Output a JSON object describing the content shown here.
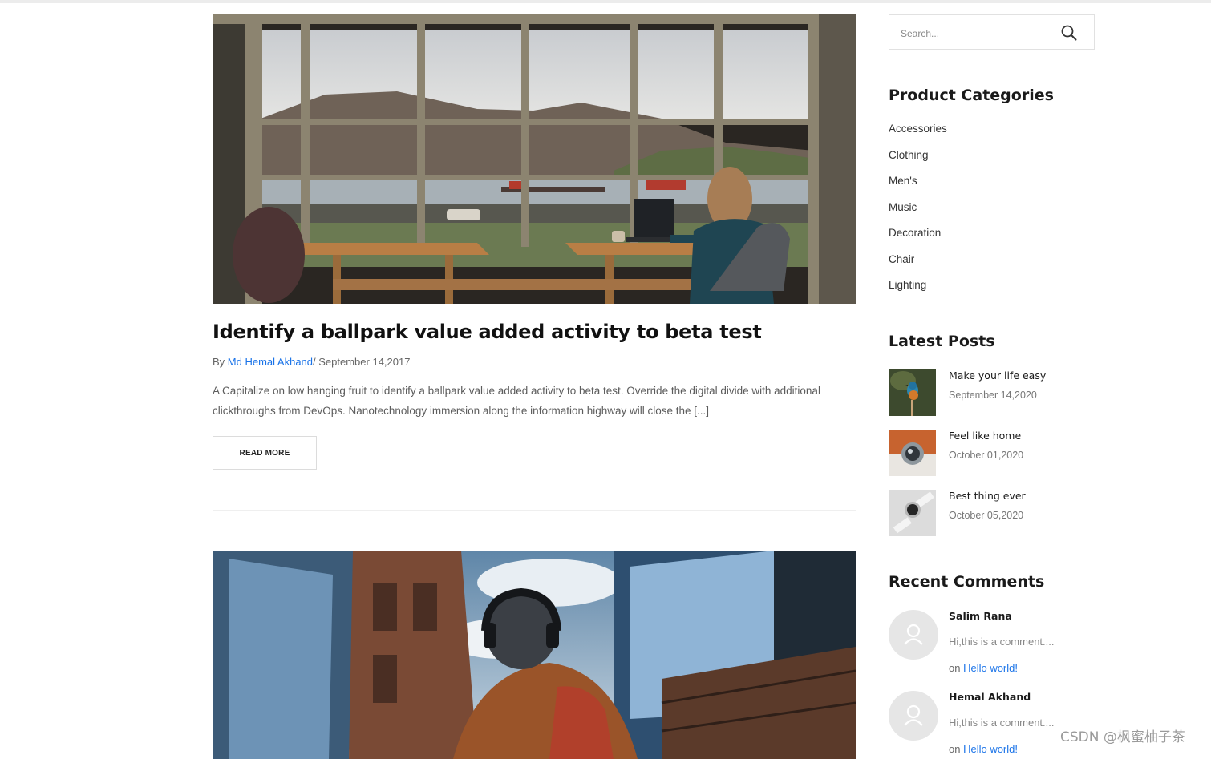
{
  "post": {
    "image_alt": "Woman working on a laptop at a desk in front of large windows overlooking a fjord",
    "title": "Identify a ballpark value added activity to beta test",
    "by_label": "By ",
    "author": "Md Hemal Akhand",
    "date": "/ September 14,2017",
    "excerpt": "A Capitalize on low hanging fruit to identify a ballpark value added activity to beta test. Override the digital divide with additional clickthroughs from DevOps. Nanotechnology immersion along the information highway will close the [...]",
    "read_more": "READ MORE"
  },
  "post2": {
    "image_alt": "Person wearing headphones and a backpack walking between glass city buildings"
  },
  "sidebar": {
    "search_placeholder": "Search...",
    "categories_title": "Product Categories",
    "categories": [
      "Accessories",
      "Clothing",
      "Men's",
      "Music",
      "Decoration",
      "Chair",
      "Lighting"
    ],
    "latest_posts_title": "Latest Posts",
    "latest_posts": [
      {
        "title": "Make your life easy",
        "date": "September 14,2020",
        "thumb_icon": "kingfisher-bird-icon"
      },
      {
        "title": "Feel like home",
        "date": "October 01,2020",
        "thumb_icon": "speaker-device-icon"
      },
      {
        "title": "Best thing ever",
        "date": "October 05,2020",
        "thumb_icon": "smartwatch-icon"
      }
    ],
    "recent_comments_title": "Recent Comments",
    "recent_comments": [
      {
        "name": "Salim Rana",
        "text": "Hi,this is a comment....",
        "on_label": "on ",
        "link": "Hello world!"
      },
      {
        "name": "Hemal Akhand",
        "text": "Hi,this is a comment....",
        "on_label": "on ",
        "link": "Hello world!"
      }
    ]
  },
  "watermark": "CSDN @枫蜜柚子茶",
  "colors": {
    "link": "#1a73e8",
    "heading": "#111111",
    "body_text": "#5c5c5c",
    "border": "#e1e1e1"
  }
}
